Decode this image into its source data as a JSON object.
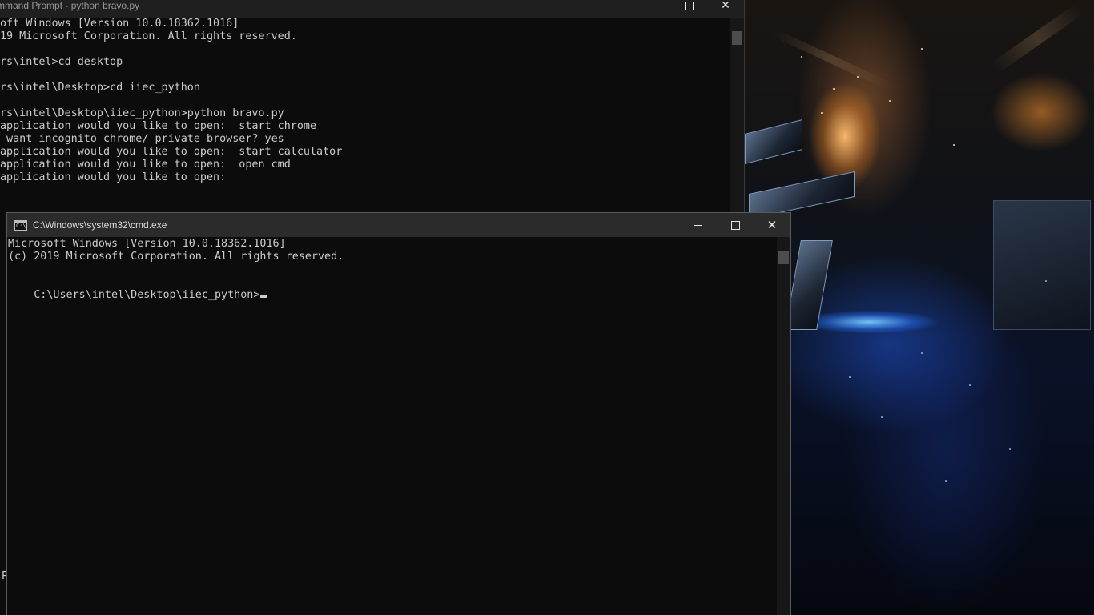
{
  "background_window": {
    "title": "mmand Prompt - python  bravo.py",
    "lines": [
      "oft Windows [Version 10.0.18362.1016]",
      "19 Microsoft Corporation. All rights reserved.",
      "",
      "rs\\intel>cd desktop",
      "",
      "rs\\intel\\Desktop>cd iiec_python",
      "",
      "rs\\intel\\Desktop\\iiec_python>python bravo.py",
      "application would you like to open:  start chrome",
      " want incognito chrome/ private browser? yes",
      "application would you like to open:  start calculator",
      "application would you like to open:  open cmd",
      "application would you like to open:"
    ],
    "stray_char": "P"
  },
  "front_window": {
    "title": "C:\\Windows\\system32\\cmd.exe",
    "icon_text": "C:\\",
    "lines": [
      "Microsoft Windows [Version 10.0.18362.1016]",
      "(c) 2019 Microsoft Corporation. All rights reserved.",
      ""
    ],
    "prompt": "C:\\Users\\intel\\Desktop\\iiec_python>"
  },
  "window_controls": {
    "minimize": "—",
    "close": "✕"
  },
  "colors": {
    "console_bg": "#0c0c0c",
    "console_text": "#cccccc",
    "titlebar_active": "#2b2b2b",
    "titlebar_inactive": "#1f1f1f"
  }
}
